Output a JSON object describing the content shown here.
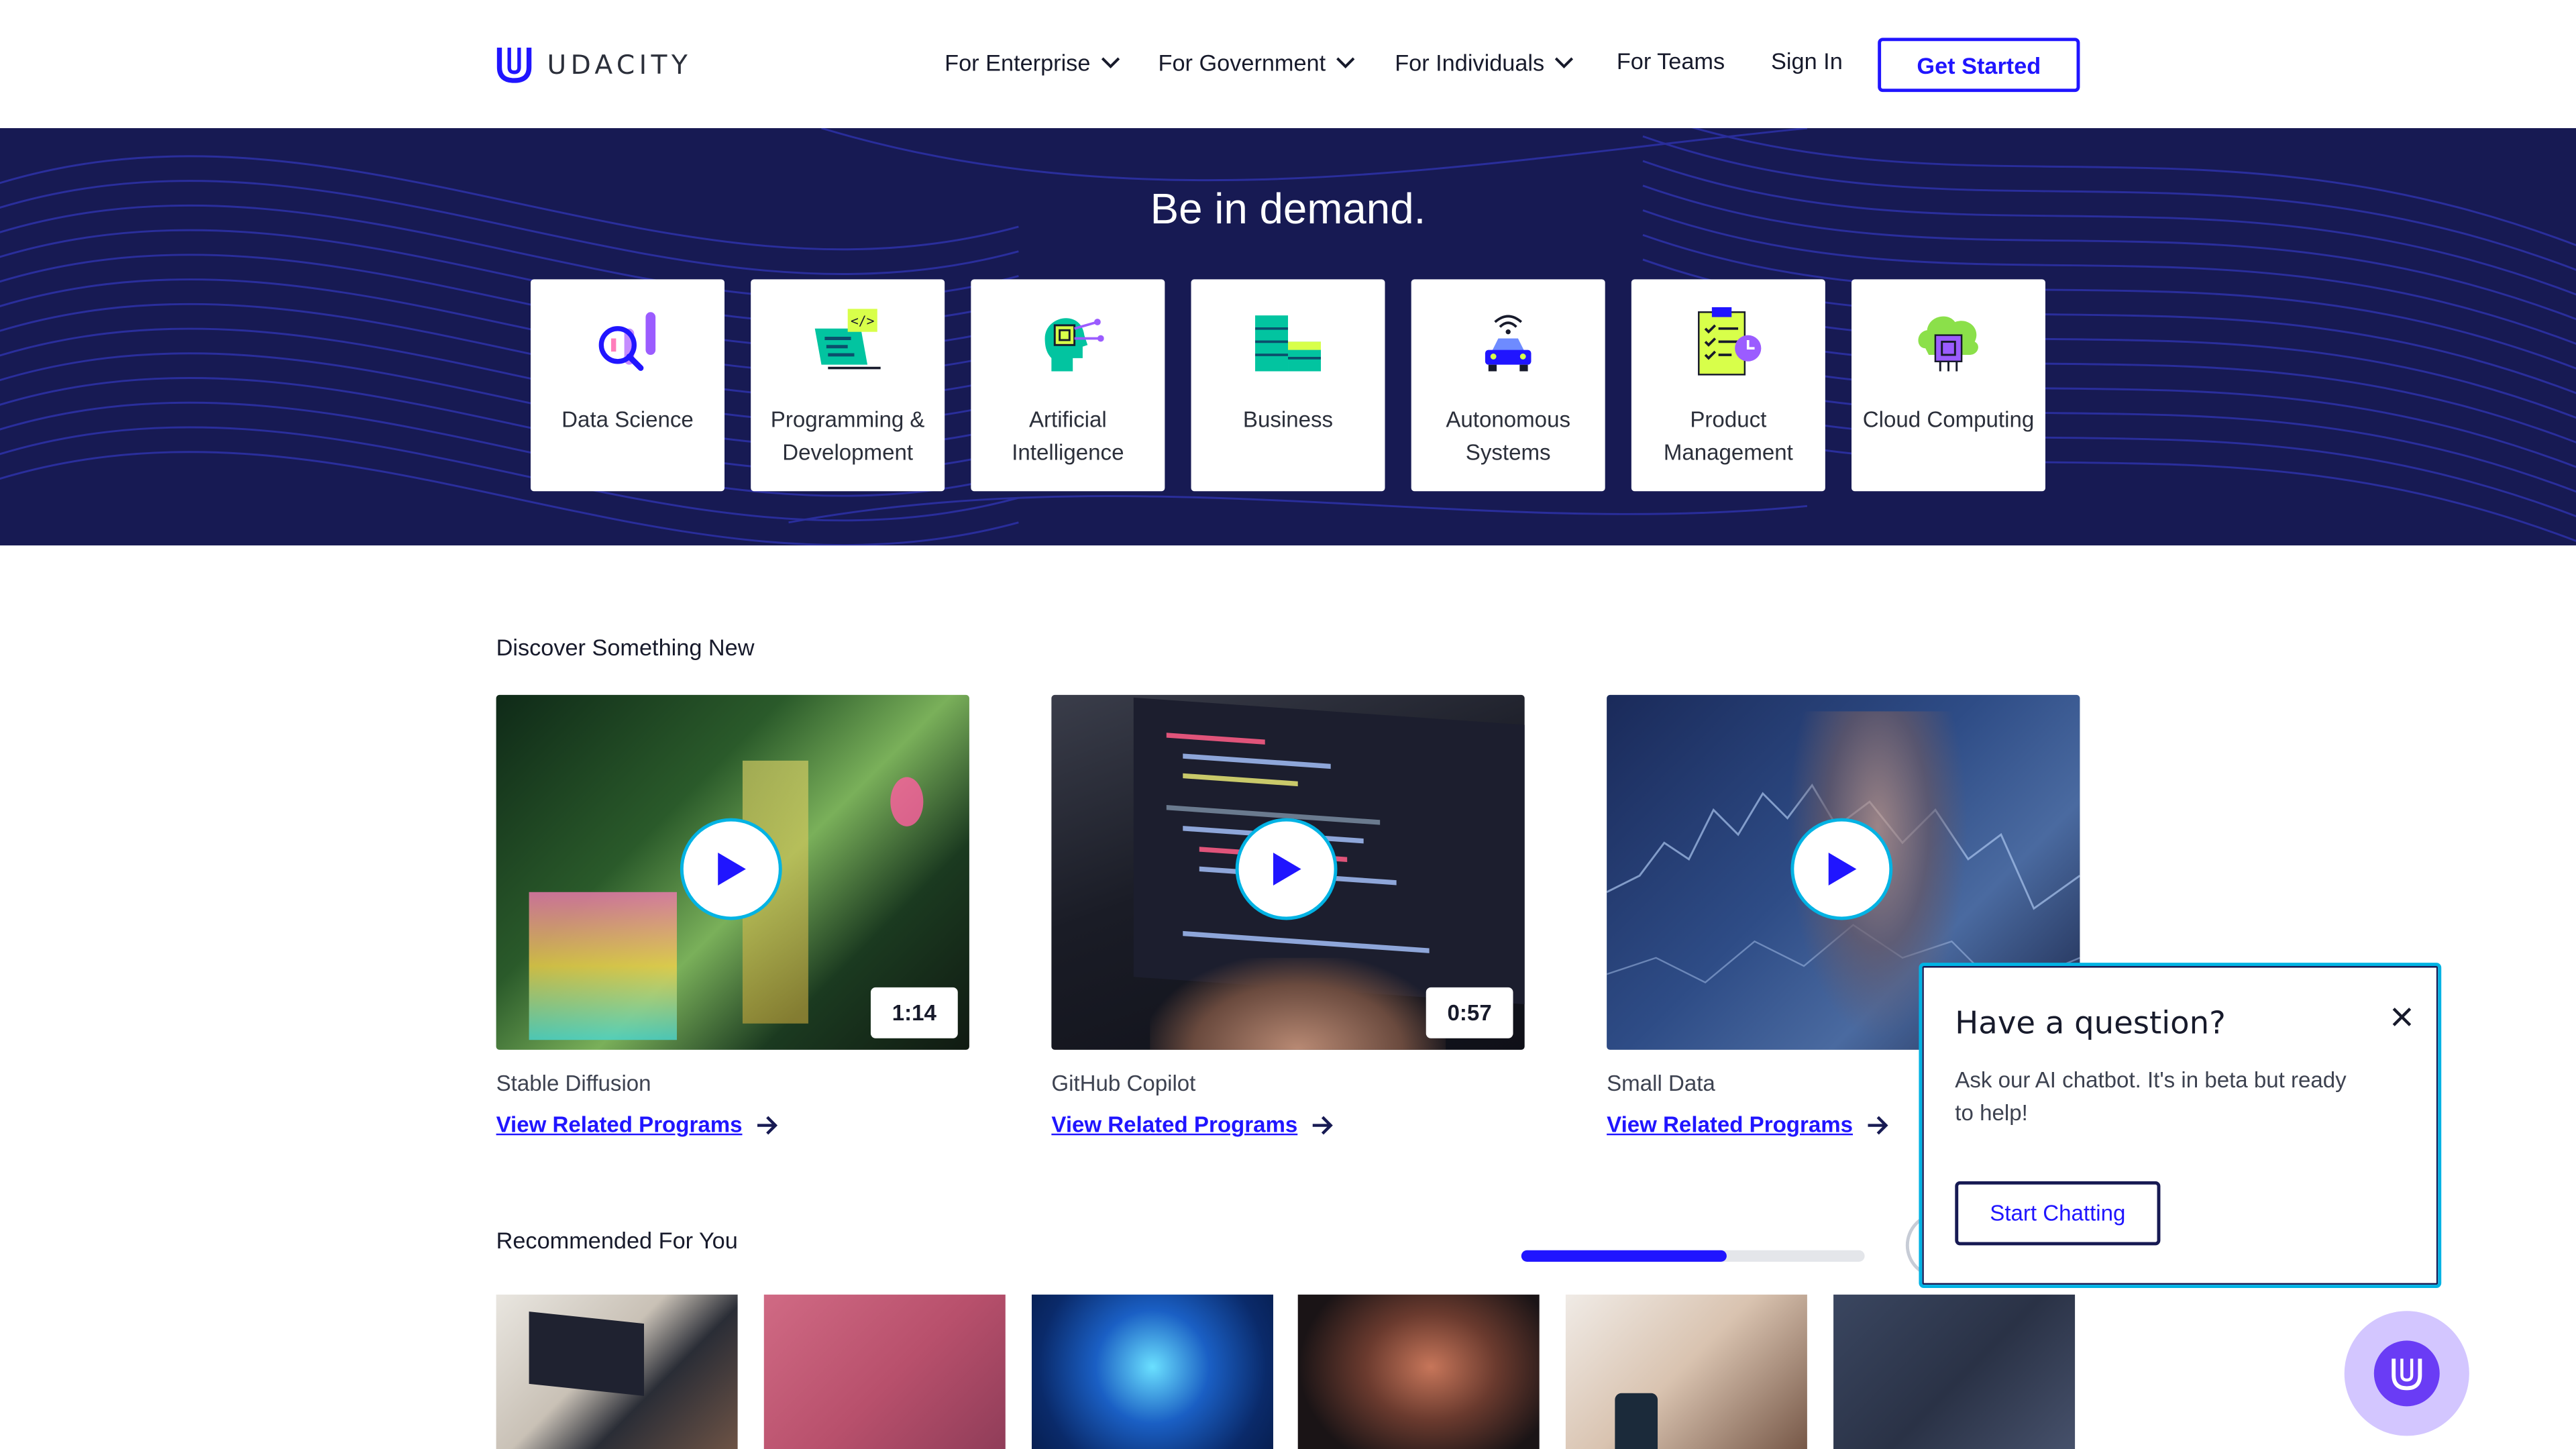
{
  "brand": {
    "name": "UDACITY",
    "logo_icon": "udacity-u-icon"
  },
  "nav": {
    "items": [
      {
        "label": "For Enterprise",
        "dropdown": true
      },
      {
        "label": "For Government",
        "dropdown": true
      },
      {
        "label": "For Individuals",
        "dropdown": true
      },
      {
        "label": "For Teams",
        "dropdown": false
      }
    ],
    "sign_in": "Sign In",
    "get_started": "Get Started"
  },
  "hero": {
    "title": "Be in demand.",
    "categories": [
      {
        "label": "Data Science",
        "icon": "data-science-icon"
      },
      {
        "label": "Programming & Development",
        "icon": "programming-icon"
      },
      {
        "label": "Artificial Intelligence",
        "icon": "ai-head-icon"
      },
      {
        "label": "Business",
        "icon": "business-icon"
      },
      {
        "label": "Autonomous Systems",
        "icon": "autonomous-car-icon"
      },
      {
        "label": "Product Management",
        "icon": "clipboard-icon"
      },
      {
        "label": "Cloud Computing",
        "icon": "cloud-chip-icon"
      }
    ]
  },
  "discover": {
    "title": "Discover Something New",
    "videos": [
      {
        "title": "Stable Diffusion",
        "duration": "1:14",
        "link": "View Related Programs"
      },
      {
        "title": "GitHub Copilot",
        "duration": "0:57",
        "link": "View Related Programs"
      },
      {
        "title": "Small Data",
        "duration": "",
        "link": "View Related Programs"
      }
    ]
  },
  "recommended": {
    "title": "Recommended For You",
    "carousel_progress": 0.6
  },
  "chat": {
    "title": "Have a question?",
    "text": "Ask our AI chatbot. It's in beta but ready to help!",
    "button": "Start Chatting"
  },
  "colors": {
    "brand_blue": "#2015ff",
    "hero_navy": "#171a53",
    "accent_cyan": "#02b3e4"
  }
}
